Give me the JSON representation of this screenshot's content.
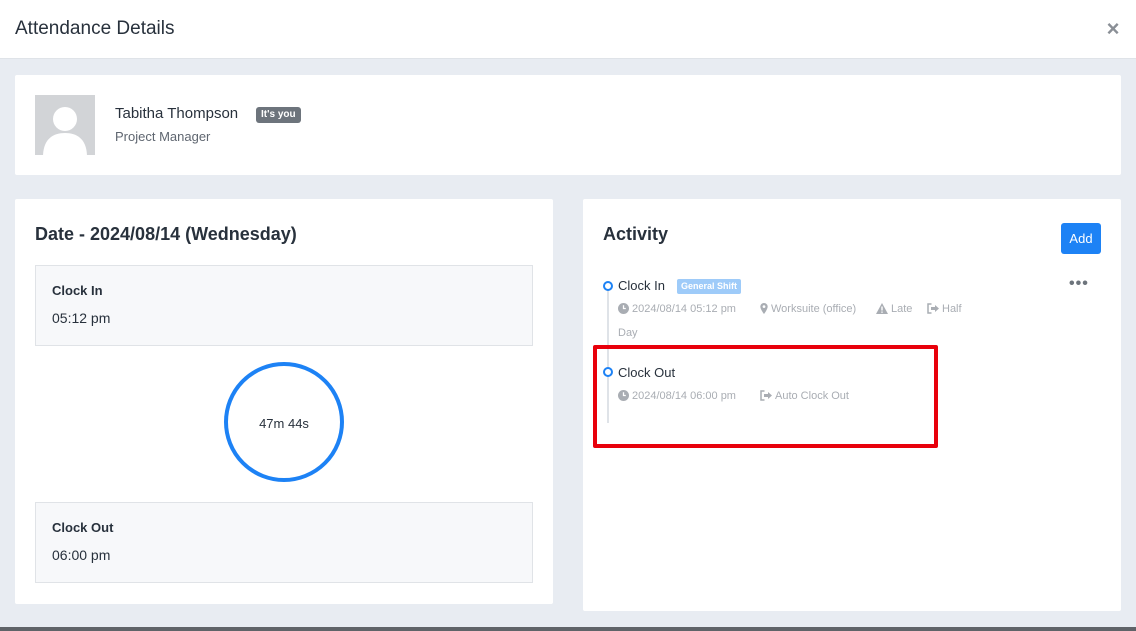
{
  "modal": {
    "title": "Attendance Details",
    "close_label": "×"
  },
  "user": {
    "name": "Tabitha Thompson",
    "badge": "It's you",
    "role": "Project Manager"
  },
  "date_panel": {
    "title": "Date - 2024/08/14 (Wednesday)",
    "clock_in": {
      "label": "Clock In",
      "time": "05:12 pm"
    },
    "duration": "47m 44s",
    "clock_out": {
      "label": "Clock Out",
      "time": "06:00 pm"
    }
  },
  "activity": {
    "title": "Activity",
    "add_label": "Add",
    "more_label": "•••",
    "entries": [
      {
        "title": "Clock In",
        "badge": "General Shift",
        "datetime": "2024/08/14 05:12 pm",
        "location": "Worksuite (office)",
        "late": "Late",
        "half": "Half",
        "half_day": "Day"
      },
      {
        "title": "Clock Out",
        "datetime": "2024/08/14 06:00 pm",
        "note": "Auto Clock Out"
      }
    ]
  },
  "colors": {
    "accent": "#1d82f5",
    "highlight": "#e8000b",
    "badge": "#6d747c",
    "shift_badge": "#9ecbf9"
  },
  "icons": [
    "close-icon",
    "avatar-placeholder",
    "clock-icon",
    "map-marker-icon",
    "warning-icon",
    "sign-out-icon",
    "ellipsis-icon"
  ]
}
